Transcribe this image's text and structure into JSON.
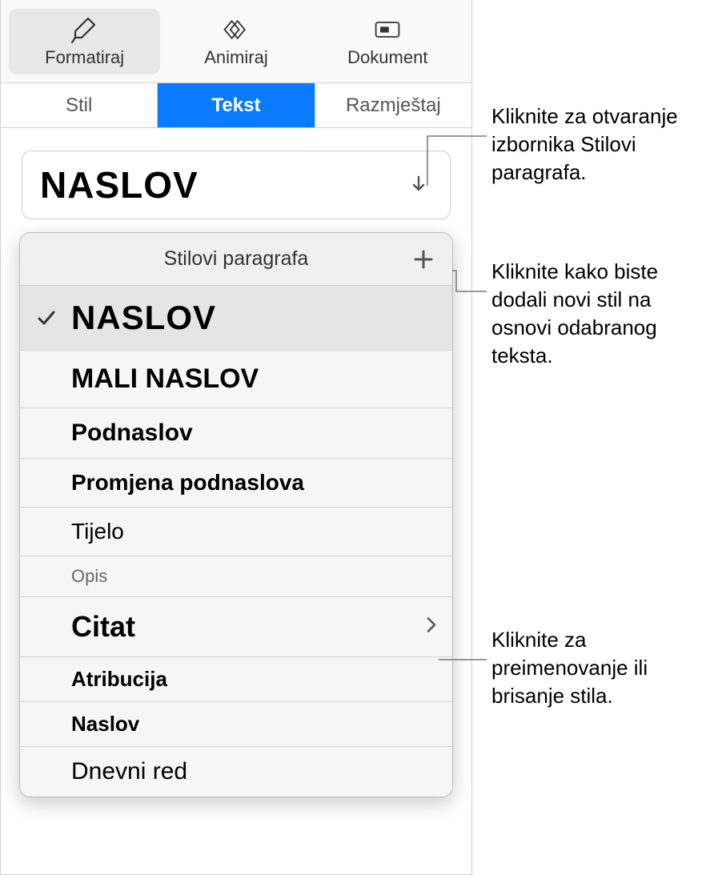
{
  "toolbar": {
    "format_label": "Formatiraj",
    "animate_label": "Animiraj",
    "document_label": "Dokument"
  },
  "tabs": {
    "style": "Stil",
    "text": "Tekst",
    "layout": "Razmještaj"
  },
  "style_selector": {
    "current": "NASLOV"
  },
  "popover": {
    "title": "Stilovi paragrafa"
  },
  "styles": [
    {
      "label": "NASLOV",
      "selected": true,
      "class": "style-name-big",
      "chevron": false
    },
    {
      "label": "MALI NASLOV",
      "selected": false,
      "class": "style-name-small-title",
      "chevron": false
    },
    {
      "label": "Podnaslov",
      "selected": false,
      "class": "style-name-sub",
      "chevron": false
    },
    {
      "label": "Promjena podnaslova",
      "selected": false,
      "class": "style-name-subchange",
      "chevron": false
    },
    {
      "label": "Tijelo",
      "selected": false,
      "class": "style-name-body",
      "chevron": false
    },
    {
      "label": "Opis",
      "selected": false,
      "class": "style-name-desc",
      "chevron": false
    },
    {
      "label": "Citat",
      "selected": false,
      "class": "style-name-quote",
      "chevron": true
    },
    {
      "label": "Atribucija",
      "selected": false,
      "class": "style-name-attr",
      "chevron": false
    },
    {
      "label": "Naslov",
      "selected": false,
      "class": "style-name-title2",
      "chevron": false
    },
    {
      "label": "Dnevni red",
      "selected": false,
      "class": "style-name-agenda",
      "chevron": false
    }
  ],
  "callouts": {
    "open_menu": "Kliknite za otvaranje izbornika Stilovi paragrafa.",
    "add_style": "Kliknite kako biste dodali novi stil na osnovi odabranog teksta.",
    "rename_delete": "Kliknite za preimenovanje ili brisanje stila."
  }
}
